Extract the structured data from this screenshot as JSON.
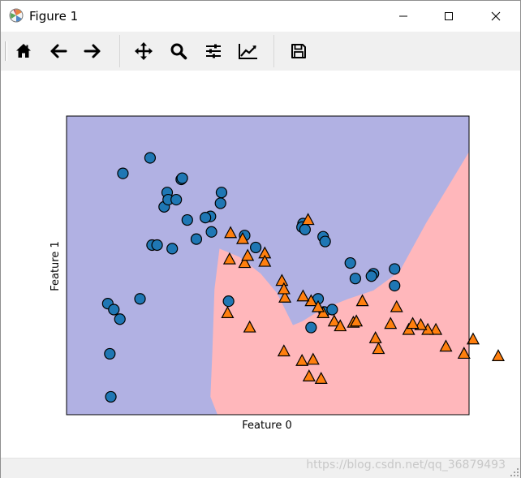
{
  "window": {
    "title": "Figure 1"
  },
  "toolbar": {
    "buttons": [
      {
        "icon": "home-icon"
      },
      {
        "icon": "back-arrow-icon"
      },
      {
        "icon": "forward-arrow-icon"
      },
      {
        "icon": "pan-icon"
      },
      {
        "icon": "zoom-icon"
      },
      {
        "icon": "subplots-icon"
      },
      {
        "icon": "axes-edit-icon"
      },
      {
        "icon": "save-icon"
      }
    ]
  },
  "status": {
    "watermark": "https://blog.csdn.net/qq_36879493"
  },
  "colors": {
    "class0_fill": "#1f77b4",
    "class1_fill": "#ff7f0e",
    "region0": "#b1b1e3",
    "region1": "#ffb7bb"
  },
  "chart_data": {
    "type": "scatter",
    "title": "",
    "xlabel": "Feature 0",
    "ylabel": "Feature 1",
    "xlim": [
      -1.5,
      2.5
    ],
    "ylim": [
      -1.0,
      1.5
    ],
    "xticks": [],
    "yticks": [],
    "legend": "none",
    "grid": false,
    "decision_boundary": {
      "region_above": "class 0",
      "region_below": "class 1",
      "boundary": [
        [
          0.0,
          -1.0
        ],
        [
          -0.07,
          -0.85
        ],
        [
          -0.05,
          -0.45
        ],
        [
          -0.03,
          0.05
        ],
        [
          0.02,
          0.39
        ],
        [
          0.22,
          0.32
        ],
        [
          0.43,
          0.18
        ],
        [
          0.59,
          0.02
        ],
        [
          0.75,
          -0.25
        ],
        [
          0.84,
          -0.22
        ],
        [
          1.03,
          -0.12
        ],
        [
          1.3,
          -0.03
        ],
        [
          1.55,
          0.04
        ],
        [
          1.81,
          0.2
        ],
        [
          2.07,
          0.6
        ],
        [
          2.5,
          1.2
        ]
      ]
    },
    "series": [
      {
        "marker": "circle",
        "x": [
          -0.53,
          -0.5,
          -0.94,
          -0.67,
          -0.07,
          -0.06,
          -0.36,
          -0.35,
          -0.3,
          -0.12,
          0.27,
          0.38,
          0.85,
          0.84,
          0.87,
          1.05,
          1.07,
          1.32,
          1.37,
          1.55,
          1.53,
          1.76,
          1.76,
          1.0,
          1.06,
          1.14,
          -0.49,
          -0.41,
          -0.65,
          -0.6,
          -0.45,
          0.04,
          0.03,
          -0.97,
          -0.77,
          -1.09,
          -1.07,
          -1.06,
          -0.21,
          -1.03,
          0.11,
          0.93
        ],
        "y": [
          0.74,
          0.86,
          1.02,
          1.15,
          0.66,
          0.53,
          0.97,
          0.98,
          0.63,
          0.65,
          0.5,
          0.4,
          0.6,
          0.57,
          0.55,
          0.49,
          0.45,
          0.27,
          0.14,
          0.18,
          0.16,
          0.22,
          0.08,
          -0.03,
          -0.14,
          -0.12,
          0.8,
          0.8,
          0.42,
          0.42,
          0.39,
          0.86,
          0.77,
          -0.2,
          -0.03,
          -0.07,
          -0.49,
          -0.85,
          0.47,
          -0.12,
          -0.05,
          -0.27
        ]
      },
      {
        "marker": "triangle",
        "x": [
          0.9,
          0.13,
          0.25,
          0.27,
          0.67,
          0.93,
          1.05,
          1.16,
          1.22,
          1.35,
          0.12,
          0.3,
          0.47,
          0.47,
          0.64,
          0.66,
          0.85,
          1.0,
          1.38,
          1.72,
          1.9,
          2.17,
          2.54,
          2.79,
          2.45,
          2.27,
          2.09,
          2.02,
          1.94,
          1.78,
          1.44,
          1.57,
          1.6,
          0.1,
          0.32,
          0.66,
          0.84,
          0.95,
          0.91,
          1.03
        ],
        "y": [
          0.63,
          0.52,
          0.47,
          0.27,
          -0.02,
          -0.05,
          -0.15,
          -0.22,
          -0.26,
          -0.23,
          0.3,
          0.33,
          0.35,
          0.28,
          0.12,
          0.05,
          -0.01,
          -0.1,
          -0.22,
          -0.24,
          -0.29,
          -0.29,
          -0.37,
          -0.51,
          -0.49,
          -0.43,
          -0.29,
          -0.25,
          -0.24,
          -0.1,
          -0.05,
          -0.36,
          -0.45,
          -0.15,
          -0.27,
          -0.47,
          -0.55,
          -0.54,
          -0.68,
          -0.7
        ]
      }
    ]
  }
}
